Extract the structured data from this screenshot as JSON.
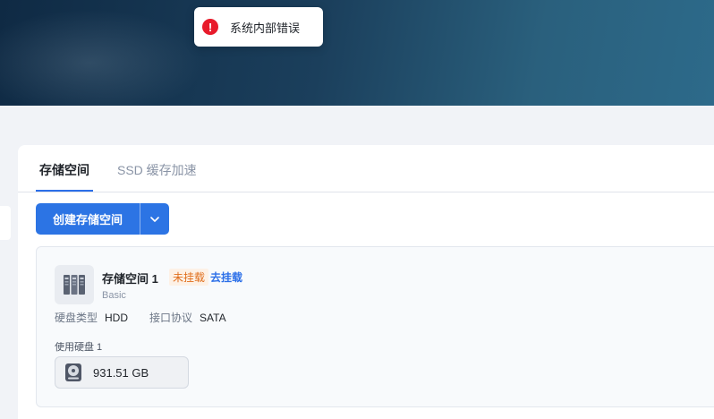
{
  "toast": {
    "message": "系统内部错误",
    "icon": "error-icon",
    "color": "#e81b2b"
  },
  "tabs": [
    {
      "label": "存储空间",
      "active": true
    },
    {
      "label": "SSD 缓存加速",
      "active": false
    }
  ],
  "toolbar": {
    "create_label": "创建存储空间",
    "dropdown_icon": "chevron-down-icon"
  },
  "pool": {
    "name": "存储空间 1",
    "mount_status": "未挂载",
    "mount_action": "去挂载",
    "type": "Basic",
    "disk_type_label": "硬盘类型",
    "disk_type_value": "HDD",
    "interface_label": "接口协议",
    "interface_value": "SATA",
    "used_disks_label": "使用硬盘 1",
    "disk_size": "931.51 GB"
  },
  "colors": {
    "accent": "#2c74e4",
    "warning": "#e06e1c"
  }
}
